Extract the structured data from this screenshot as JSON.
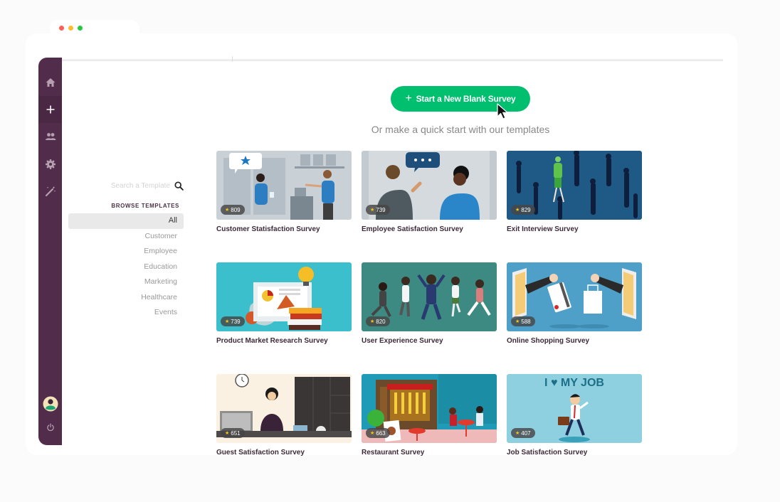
{
  "window": {
    "controls": [
      {
        "name": "close",
        "color": "#fe5f57"
      },
      {
        "name": "minimize",
        "color": "#febc2e"
      },
      {
        "name": "maximize",
        "color": "#28c840"
      }
    ]
  },
  "sidebar": {
    "items": [
      {
        "name": "home",
        "icon": "home-icon",
        "active": false
      },
      {
        "name": "create",
        "icon": "plus-icon",
        "active": true
      },
      {
        "name": "users",
        "icon": "users-icon",
        "active": false
      },
      {
        "name": "settings",
        "icon": "gear-icon",
        "active": false
      },
      {
        "name": "magic",
        "icon": "magic-wand-icon",
        "active": false
      }
    ],
    "bottom": [
      {
        "name": "profile",
        "icon": "avatar-icon"
      },
      {
        "name": "logout",
        "icon": "power-icon"
      }
    ],
    "color": "#522d4b"
  },
  "search": {
    "placeholder": "Search a Template",
    "value": ""
  },
  "browse": {
    "title": "BROWSE TEMPLATES",
    "categories": [
      {
        "label": "All",
        "active": true
      },
      {
        "label": "Customer",
        "active": false
      },
      {
        "label": "Employee",
        "active": false
      },
      {
        "label": "Education",
        "active": false
      },
      {
        "label": "Marketing",
        "active": false
      },
      {
        "label": "Healthcare",
        "active": false
      },
      {
        "label": "Events",
        "active": false
      }
    ]
  },
  "main": {
    "new_button_label": "Start a New Blank Survey",
    "accent_color": "#00bf6f",
    "subtitle": "Or make a quick start with our templates"
  },
  "templates": [
    {
      "title": "Customer Statisfaction Survey",
      "rating_count": "809",
      "theme": "customer"
    },
    {
      "title": "Employee Satisfaction Survey",
      "rating_count": "739",
      "theme": "employee"
    },
    {
      "title": "Exit Interview Survey",
      "rating_count": "829",
      "theme": "exit"
    },
    {
      "title": "Product Market Research Survey",
      "rating_count": "739",
      "theme": "market"
    },
    {
      "title": "User Experience Survey",
      "rating_count": "820",
      "theme": "ux"
    },
    {
      "title": "Online Shopping Survey",
      "rating_count": "588",
      "theme": "shopping"
    },
    {
      "title": "Guest Satisfaction Survey",
      "rating_count": "651",
      "theme": "guest"
    },
    {
      "title": "Restaurant Survey",
      "rating_count": "663",
      "theme": "restaurant"
    },
    {
      "title": "Job Satisfaction Survey",
      "rating_count": "407",
      "theme": "job",
      "banner_text": "I ♥ MY JOB"
    }
  ]
}
